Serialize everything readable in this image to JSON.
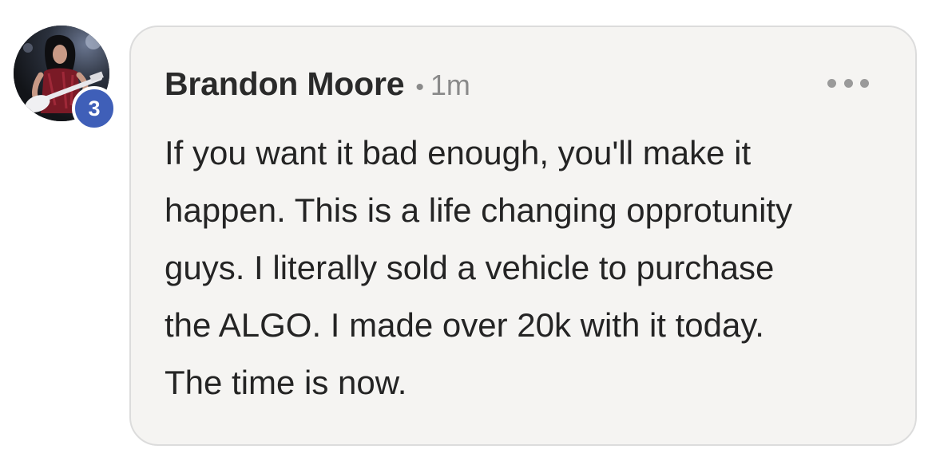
{
  "comment": {
    "author": "Brandon Moore",
    "separator": "•",
    "time": "1m",
    "badge_count": "3",
    "more_icon": "more-horizontal-icon",
    "lines": [
      "If you want it bad enough, you'll make it",
      "happen. This is a life changing opprotunity",
      "guys. I literally sold a vehicle to purchase",
      "the ALGO. I made over 20k with it today.",
      "The time is now."
    ],
    "colors": {
      "bubble": "#f5f4f2",
      "bubble_border": "#dcdcdc",
      "badge": "#3f5fb8",
      "author": "#2a2a2a",
      "muted": "#8a8a8a"
    }
  }
}
